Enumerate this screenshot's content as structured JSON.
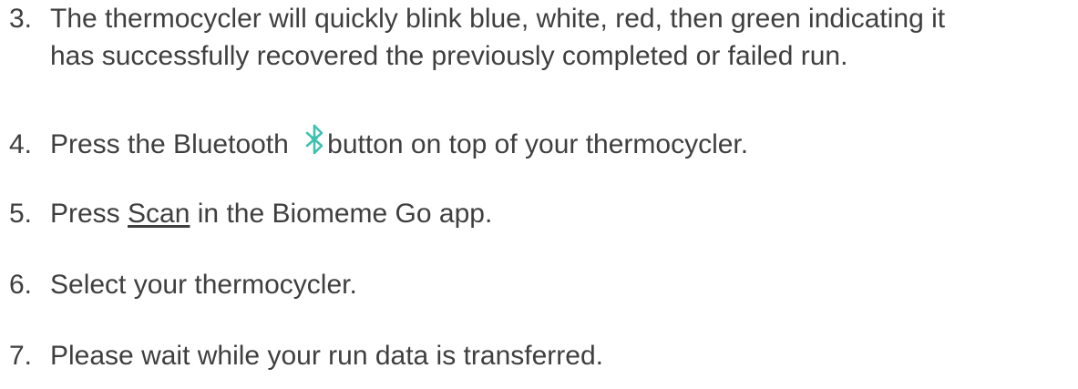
{
  "steps": [
    {
      "number": "3.",
      "line1": "The thermocycler will quickly blink blue, white, red, then green indicating it",
      "line2": "has successfully recovered the previously completed or failed run."
    },
    {
      "number": "4.",
      "before": "Press the Bluetooth",
      "icon": "bluetooth-icon",
      "after": "button on top of your thermocycler."
    },
    {
      "number": "5.",
      "before": "Press",
      "link": "Scan",
      "after": "in the Biomeme Go app."
    },
    {
      "number": "6.",
      "text": "Select your thermocycler."
    },
    {
      "number": "7.",
      "text": "Please wait while your run data is transferred."
    }
  ],
  "colors": {
    "text": "#3f3f3f",
    "bluetooth_icon": "#3fc1b0"
  }
}
